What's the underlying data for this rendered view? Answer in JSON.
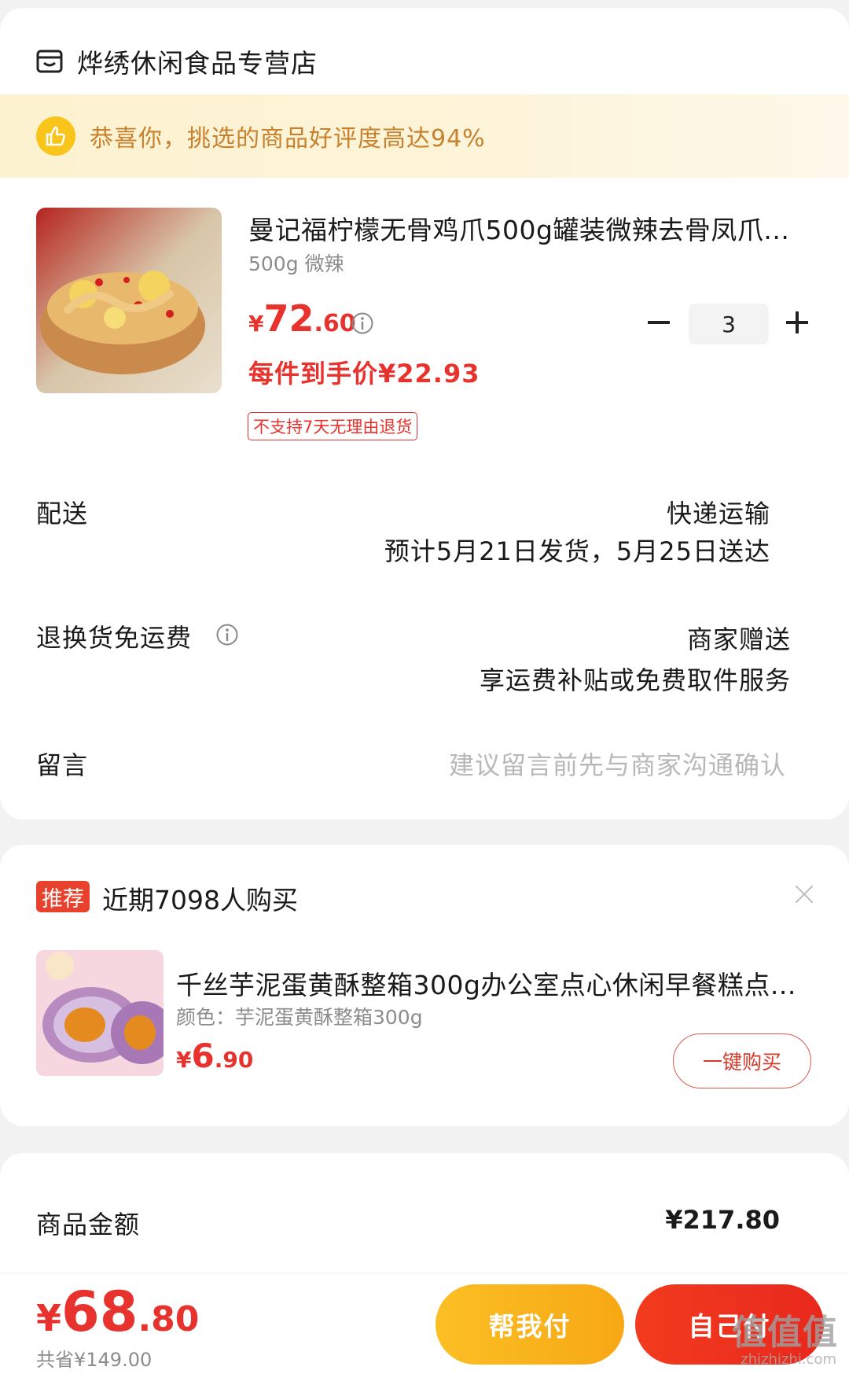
{
  "store": {
    "name": "烨绣休闲食品专营店",
    "icon": "store-icon"
  },
  "banner": {
    "text": "恭喜你，挑选的商品好评度高达94%",
    "icon": "thumbs-up-icon"
  },
  "product": {
    "title": "曼记福柠檬无骨鸡爪500g罐装微辣去骨凤爪...",
    "spec": "500g 微辣",
    "price_symbol": "¥",
    "price_int": "72",
    "price_dec": ".60",
    "per_price": "每件到手价¥22.93",
    "return_tag": "不支持7天无理由退货",
    "quantity": "3"
  },
  "shipping": {
    "label": "配送",
    "method": "快递运输",
    "time": "预计5月21日发货，5月25日送达"
  },
  "return_shipping": {
    "label": "退换货免运费",
    "value": "商家赠送",
    "desc": "享运费补贴或免费取件服务"
  },
  "message": {
    "label": "留言",
    "placeholder": "建议留言前先与商家沟通确认"
  },
  "recommend": {
    "badge": "推荐",
    "headline": "近期7098人购买",
    "title": "千丝芋泥蛋黄酥整箱300g办公室点心休闲早餐糕点...",
    "spec": "颜色：芋泥蛋黄酥整箱300g",
    "price_symbol": "¥",
    "price_int": "6",
    "price_dec": ".90",
    "buy_label": "一键购买"
  },
  "summary": {
    "amount_label": "商品金额",
    "amount_value": "¥217.80"
  },
  "bottom": {
    "total_symbol": "¥",
    "total_int": "68",
    "total_dec": ".80",
    "saved": "共省¥149.00",
    "helper_label": "帮我付",
    "self_label": "自己付"
  },
  "watermark": {
    "text": "值值值",
    "sub": "zhizhizhi.com"
  },
  "colors": {
    "accent_red": "#e8322d",
    "banner_text": "#c7812f",
    "helper_button": "#f7a814",
    "self_button": "#e8281d"
  }
}
